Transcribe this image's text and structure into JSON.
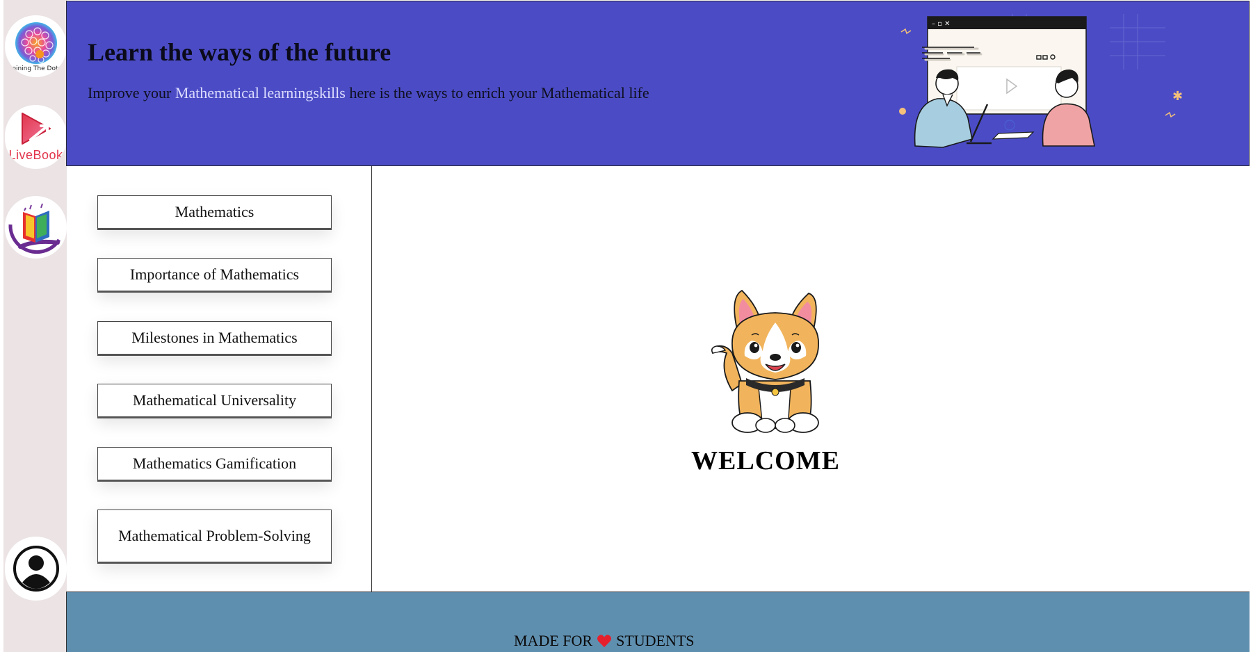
{
  "sidebar": {
    "items": [
      {
        "name": "joining-the-dots",
        "label": "Joining The Dots"
      },
      {
        "name": "livebook",
        "label": "LiveBook"
      },
      {
        "name": "reading-book"
      },
      {
        "name": "user-profile"
      }
    ]
  },
  "header": {
    "title": "Learn the ways of the future",
    "subtitle_prefix": "Improve your ",
    "subtitle_highlight": "Mathematical learningskills",
    "subtitle_suffix": " here is the ways to enrich your Mathematical life"
  },
  "menu": {
    "items": [
      "Mathematics",
      "Importance of Mathematics",
      "Milestones in Mathematics",
      "Mathematical Universality",
      "Mathematics Gamification",
      "Mathematical Problem-Solving"
    ]
  },
  "main": {
    "welcome": "WELCOME"
  },
  "footer": {
    "made_for": "MADE FOR",
    "students": "STUDENTS"
  },
  "colors": {
    "header_bg": "#4b4cc5",
    "footer_bg": "#5f8faf",
    "rail_bg": "#ebe3e4",
    "highlight_text": "#dcdcff",
    "heart": "#e5202c"
  },
  "icons": [
    "joining-dots-logo-icon",
    "livebook-logo-icon",
    "book-logo-icon",
    "user-avatar-icon",
    "heart-icon",
    "dog-mascot-icon"
  ]
}
